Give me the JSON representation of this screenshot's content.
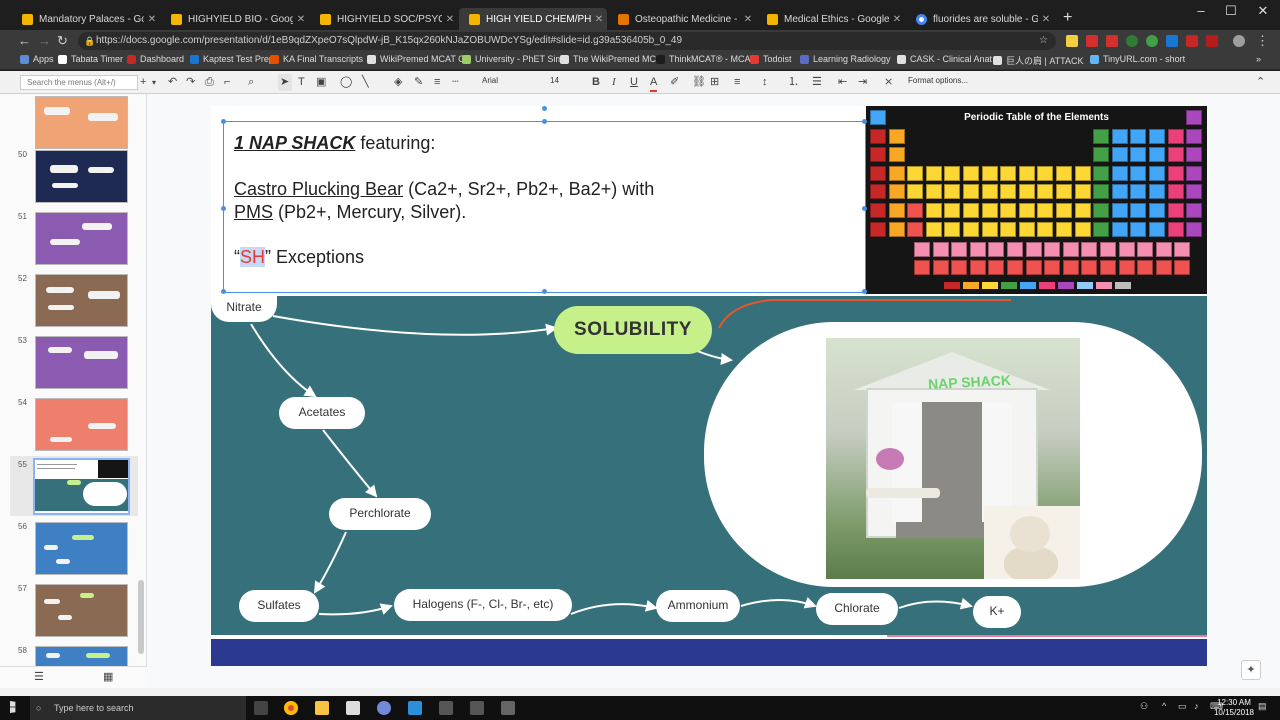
{
  "browser": {
    "tabs": [
      {
        "label": "Mandatory Palaces - Google Slides",
        "icon": "slides-icon"
      },
      {
        "label": "HIGHYIELD BIO - Google Slides",
        "icon": "slides-icon"
      },
      {
        "label": "HIGHYIELD SOC/PSYCH - Google",
        "icon": "slides-icon"
      },
      {
        "label": "HIGH YIELD CHEM/PHYS MCAT",
        "icon": "slides-icon",
        "active": true
      },
      {
        "label": "Osteopathic Medicine - Google",
        "icon": "slides-icon"
      },
      {
        "label": "Medical Ethics - Google Slides",
        "icon": "slides-icon"
      },
      {
        "label": "fluorides are soluble - Google Se",
        "icon": "google-icon"
      }
    ],
    "url": "https://docs.google.com/presentation/d/1eB9qdZXpeO7sQlpdW-jB_K15qx260kNJaZOBUWDcYSg/edit#slide=id.g39a536405b_0_49",
    "bookmarks": [
      "Apps",
      "Tabata Timer",
      "Dashboard",
      "Kaptest Test Prep",
      "KA Final Transcripts",
      "WikiPremed MCAT C",
      "University - PhET Sim",
      "The WikiPremed MC",
      "ThinkMCAT® - MCAT",
      "Todoist",
      "Learning Radiology",
      "CASK - Clinical Anat",
      "巨人の肩 | ATTACK",
      "TinyURL.com - short"
    ]
  },
  "toolbar": {
    "search_placeholder": "Search the menus (Alt+/)",
    "font": "Arial",
    "font_size": "14",
    "format_options": "Format options..."
  },
  "filmstrip": {
    "slides": [
      {
        "num": "50",
        "bg": "#1f2a52"
      },
      {
        "num": "51",
        "bg": "#8a5bb0"
      },
      {
        "num": "52",
        "bg": "#8a6a52"
      },
      {
        "num": "53",
        "bg": "#8a5bb0"
      },
      {
        "num": "54",
        "bg": "#ef7f6d"
      },
      {
        "num": "55",
        "bg": "#36707a",
        "selected": true
      },
      {
        "num": "56",
        "bg": "#3f7fc4"
      },
      {
        "num": "57",
        "bg": "#8a6a52"
      },
      {
        "num": "58",
        "bg": "#3f7fc4"
      }
    ]
  },
  "slide": {
    "line1_bold": "1 NAP SHACK",
    "line1_rest": " featuring:",
    "line2_u": "Castro Plucking Bear",
    "line2_rest": " (Ca2+, Sr2+, Pb2+, Ba2+) with",
    "line3_u": "PMS",
    "line3_rest": " (Pb2+, Mercury, Silver).",
    "line4_open": "“",
    "line4_sh": "SH",
    "line4_rest": "” Exceptions",
    "periodic_title": "Periodic Table of the Elements",
    "solubility": "SOLUBILITY",
    "photo_label": "NAP SHACK",
    "nodes": {
      "nitrate": "Nitrate",
      "acetates": "Acetates",
      "perchlorate": "Perchlorate",
      "sulfates": "Sulfates",
      "halogens": "Halogens (F-, Cl-, Br-, etc)",
      "ammonium": "Ammonium",
      "chlorate": "Chlorate",
      "kplus": "K+"
    }
  },
  "colors": {
    "teal": "#36707a",
    "lime": "#c6f08a",
    "navy": "#2b3990",
    "select_blue": "#4a90e2"
  },
  "taskbar": {
    "search": "Type here to search",
    "time": "12:30 AM",
    "date": "10/15/2018"
  }
}
